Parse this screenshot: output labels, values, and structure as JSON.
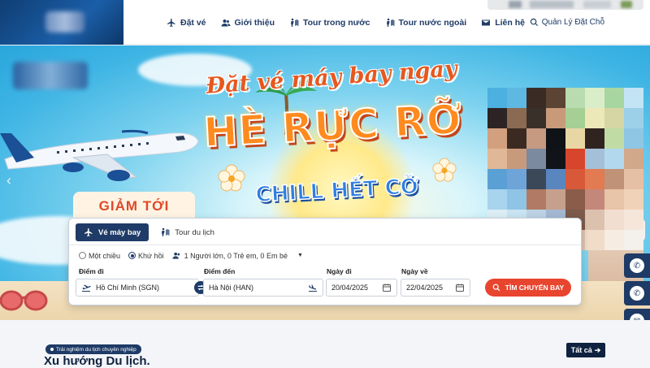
{
  "nav": {
    "items": [
      {
        "label": "Đặt vé",
        "icon": "plane-icon"
      },
      {
        "label": "Giới thiệu",
        "icon": "users-icon"
      },
      {
        "label": "Tour trong nước",
        "icon": "map-person-icon"
      },
      {
        "label": "Tour nước ngoài",
        "icon": "map-person-icon"
      },
      {
        "label": "Liên hệ",
        "icon": "mail-icon"
      }
    ],
    "manage_label": "Quản Lý Đặt Chỗ"
  },
  "hero": {
    "script_text": "Đặt vé máy bay ngay",
    "main_text": "HÈ RỰC RỠ",
    "sub_text": "CHILL HẾT CỠ",
    "discount_text": "GIẢM TỚI"
  },
  "search": {
    "tabs": [
      {
        "label": "Vé máy bay",
        "active": true
      },
      {
        "label": "Tour du lịch",
        "active": false
      }
    ],
    "trip_types": [
      {
        "label": "Một chiều",
        "checked": false
      },
      {
        "label": "Khứ hồi",
        "checked": true
      }
    ],
    "passengers": "1 Người lớn, 0 Trẻ em, 0 Em bé",
    "from_label": "Điểm đi",
    "from_value": "Hồ Chí Minh (SGN)",
    "to_label": "Điểm đến",
    "to_value": "Hà Nội (HAN)",
    "depart_label": "Ngày đi",
    "depart_value": "20/04/2025",
    "return_label": "Ngày về",
    "return_value": "22/04/2025",
    "submit_label": "TÌM CHUYẾN BAY"
  },
  "section": {
    "badge": "Trải nghiệm du lịch chuyên nghiệp",
    "title": "Xu hướng Du lịch.",
    "all_label": "Tất cả"
  },
  "colors": {
    "navy": "#1f3b67",
    "accent_red": "#e8452f",
    "headline_orange": "#ff8a1e",
    "headline_blue": "#2f7fe0"
  }
}
